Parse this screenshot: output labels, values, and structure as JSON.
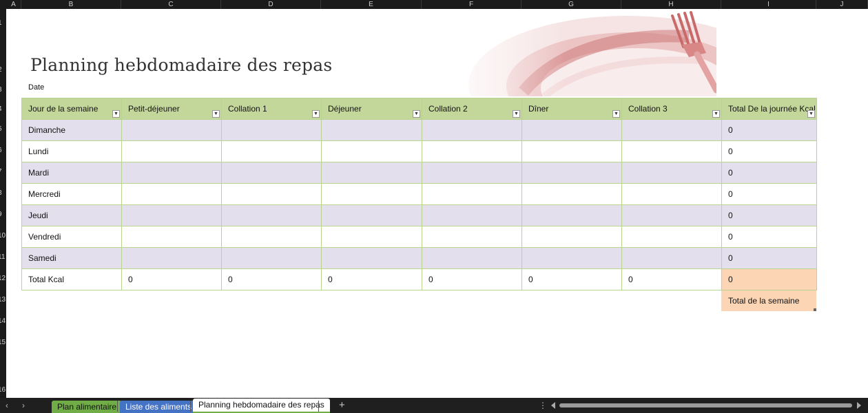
{
  "column_headers": [
    "A",
    "B",
    "C",
    "D",
    "E",
    "F",
    "G",
    "H",
    "I",
    "J"
  ],
  "row_numbers": [
    "1",
    "2",
    "3",
    "4",
    "5",
    "6",
    "7",
    "8",
    "9",
    "10",
    "11",
    "12",
    "13",
    "14",
    "15",
    "16"
  ],
  "page_title": "Planning hebdomadaire des repas",
  "date_label": "Date",
  "table": {
    "headers": [
      "Jour de la semaine",
      "Petit-déjeuner",
      "Collation 1",
      "Déjeuner",
      "Collation 2",
      "Dîner",
      "Collation 3",
      "Total De la journée Kcal"
    ],
    "rows": [
      {
        "day": "Dimanche",
        "cells": [
          "",
          "",
          "",
          "",
          "",
          ""
        ],
        "total": "0"
      },
      {
        "day": "Lundi",
        "cells": [
          "",
          "",
          "",
          "",
          "",
          ""
        ],
        "total": "0"
      },
      {
        "day": "Mardi",
        "cells": [
          "",
          "",
          "",
          "",
          "",
          ""
        ],
        "total": "0"
      },
      {
        "day": "Mercredi",
        "cells": [
          "",
          "",
          "",
          "",
          "",
          ""
        ],
        "total": "0"
      },
      {
        "day": "Jeudi",
        "cells": [
          "",
          "",
          "",
          "",
          "",
          ""
        ],
        "total": "0"
      },
      {
        "day": "Vendredi",
        "cells": [
          "",
          "",
          "",
          "",
          "",
          ""
        ],
        "total": "0"
      },
      {
        "day": "Samedi",
        "cells": [
          "",
          "",
          "",
          "",
          "",
          ""
        ],
        "total": "0"
      }
    ],
    "total_row": {
      "label": "Total Kcal",
      "cells": [
        "0",
        "0",
        "0",
        "0",
        "0",
        "0"
      ],
      "grand_total": "0"
    },
    "week_total_label": "Total de la semaine"
  },
  "sheet_tabs": [
    {
      "label": "Plan alimentaire",
      "color": "#70ad47"
    },
    {
      "label": "Liste des aliments",
      "color": "#4472c4"
    },
    {
      "label": "Planning hebdomadaire des repas",
      "active": true
    }
  ],
  "icons": {
    "add_sheet": "plus-icon",
    "prev": "chevron-left-icon",
    "next": "chevron-right-icon",
    "more": "more-vertical-icon"
  },
  "colors": {
    "header_green": "#c4d79b",
    "band_lavender": "#e4dfec",
    "total_peach": "#fcd5b4"
  }
}
